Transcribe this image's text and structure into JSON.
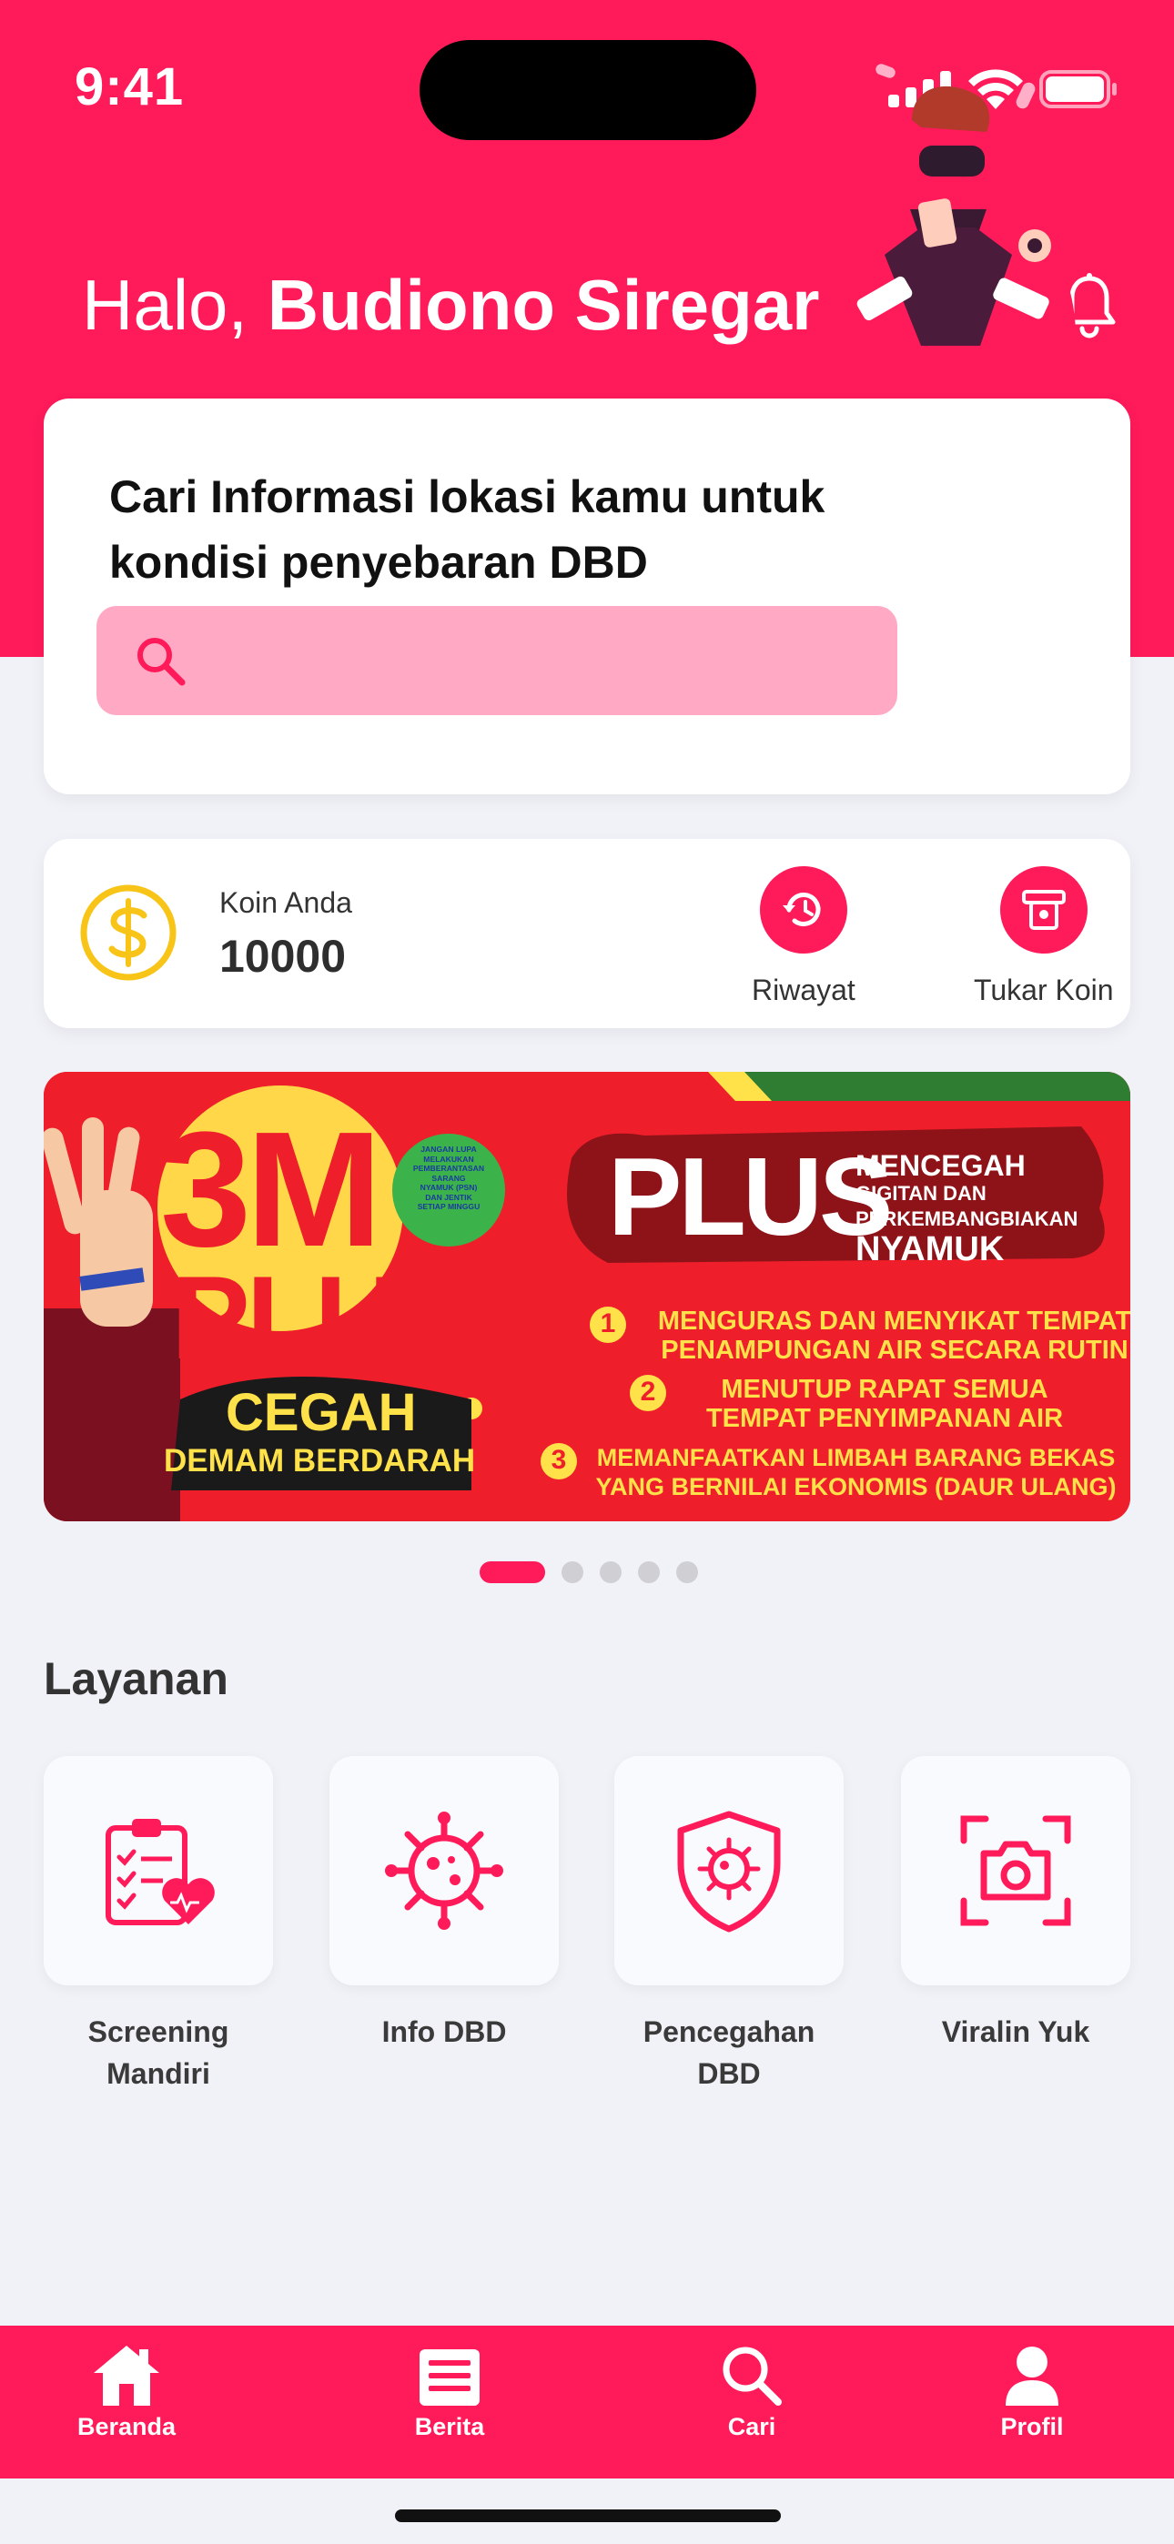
{
  "status_bar": {
    "time": "9:41"
  },
  "header": {
    "greeting_prefix": "Halo, ",
    "user_name": "Budiono Siregar"
  },
  "search_card": {
    "title": "Cari Informasi lokasi kamu untuk kondisi penyebaran DBD",
    "search_placeholder": ""
  },
  "coin_card": {
    "label": "Koin Anda",
    "value": "10000",
    "actions": [
      {
        "label": "Riwayat",
        "icon": "history-icon"
      },
      {
        "label": "Tukar Koin",
        "icon": "atm-icon"
      }
    ]
  },
  "banner": {
    "headline_3m": "3M",
    "headline_plus": "PLUS",
    "cegah": "CEGAH",
    "demam": "DEMAM BERDARAH",
    "badge_lines": [
      "JANGAN LUPA",
      "MELAKUKAN",
      "PEMBERANTASAN",
      "SARANG",
      "NYAMUK (PSN)",
      "DAN JENTIK",
      "SETIAP MINGGU"
    ],
    "plus_big": "PLUS",
    "plus_side_lines": [
      "MENCEGAH",
      "GIGITAN DAN",
      "PERKEMBANGBIAKAN",
      "NYAMUK"
    ],
    "steps": [
      {
        "num": "1",
        "lines": [
          "MENGURAS DAN MENYIKAT TEMPAT",
          "PENAMPUNGAN AIR SECARA RUTIN"
        ]
      },
      {
        "num": "2",
        "lines": [
          "MENUTUP RAPAT SEMUA",
          "TEMPAT PENYIMPANAN AIR"
        ]
      },
      {
        "num": "3",
        "lines": [
          "MEMANFAATKAN LIMBAH BARANG BEKAS",
          "YANG BERNILAI EKONOMIS (DAUR ULANG)"
        ]
      }
    ],
    "pager": {
      "count": 5,
      "active_index": 0
    }
  },
  "services": {
    "title": "Layanan",
    "items": [
      {
        "label": "Screening Mandiri",
        "icon": "clipboard-heart-icon"
      },
      {
        "label": "Info DBD",
        "icon": "virus-icon"
      },
      {
        "label": "Pencegahan DBD",
        "icon": "shield-virus-icon"
      },
      {
        "label": "Viralin Yuk",
        "icon": "camera-scan-icon"
      }
    ]
  },
  "bottom_nav": {
    "items": [
      {
        "label": "Beranda",
        "icon": "home-icon"
      },
      {
        "label": "Berita",
        "icon": "news-icon"
      },
      {
        "label": "Cari",
        "icon": "search-icon"
      },
      {
        "label": "Profil",
        "icon": "profile-icon"
      }
    ]
  },
  "colors": {
    "primary": "#FF1A5A",
    "search_fill": "#FFA9C5",
    "coin": "#F7C417",
    "background": "#F1F2F8"
  }
}
